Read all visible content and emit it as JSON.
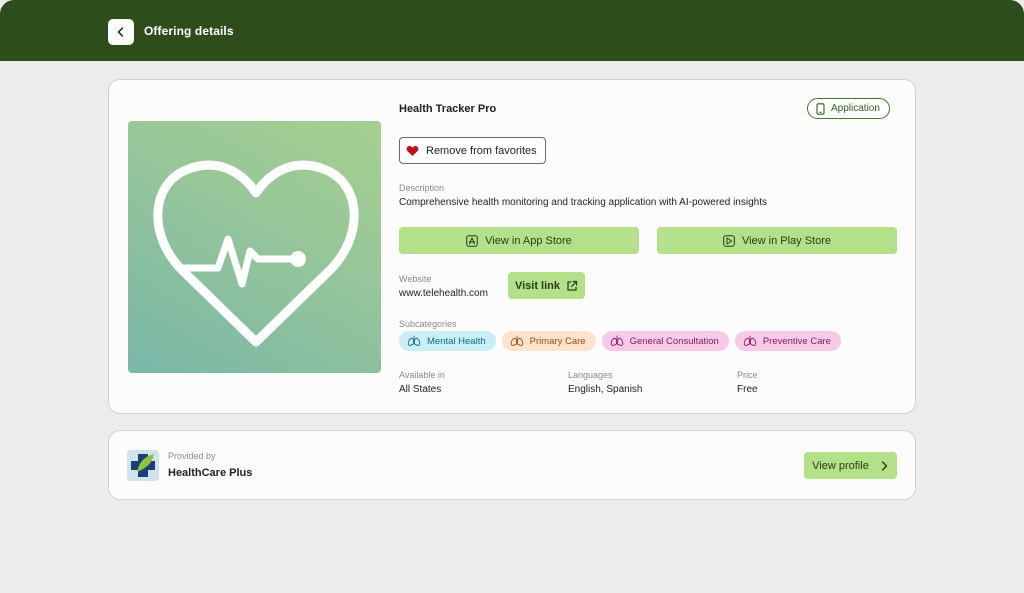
{
  "header": {
    "title": "Offering details"
  },
  "offering": {
    "name": "Health Tracker Pro",
    "type_badge": "Application",
    "favorite_button": "Remove from favorites",
    "description_label": "Description",
    "description": "Comprehensive health monitoring and tracking application with AI-powered insights",
    "app_store_button": "View in App Store",
    "play_store_button": "View in Play Store",
    "website_label": "Website",
    "website": "www.telehealth.com",
    "visit_link_button": "Visit link",
    "subcategories_label": "Subcategories",
    "subcategories": [
      {
        "label": "Mental Health",
        "bg": "#c9eef5",
        "fg": "#0f6b7d"
      },
      {
        "label": "Primary Care",
        "bg": "#fbe3cd",
        "fg": "#9a4d10"
      },
      {
        "label": "General Consultation",
        "bg": "#f7cbe7",
        "fg": "#8a1a68"
      },
      {
        "label": "Preventive Care",
        "bg": "#f7cbe7",
        "fg": "#8a1a68"
      }
    ],
    "available_label": "Available in",
    "available": "All States",
    "languages_label": "Languages",
    "languages": "English, Spanish",
    "price_label": "Price",
    "price": "Free"
  },
  "provider": {
    "label": "Provided by",
    "name": "HealthCare Plus",
    "profile_button": "View profile"
  },
  "colors": {
    "header_bg": "#2d4d1a",
    "accent_button": "#b4e08a",
    "heart": "#c0121b"
  }
}
